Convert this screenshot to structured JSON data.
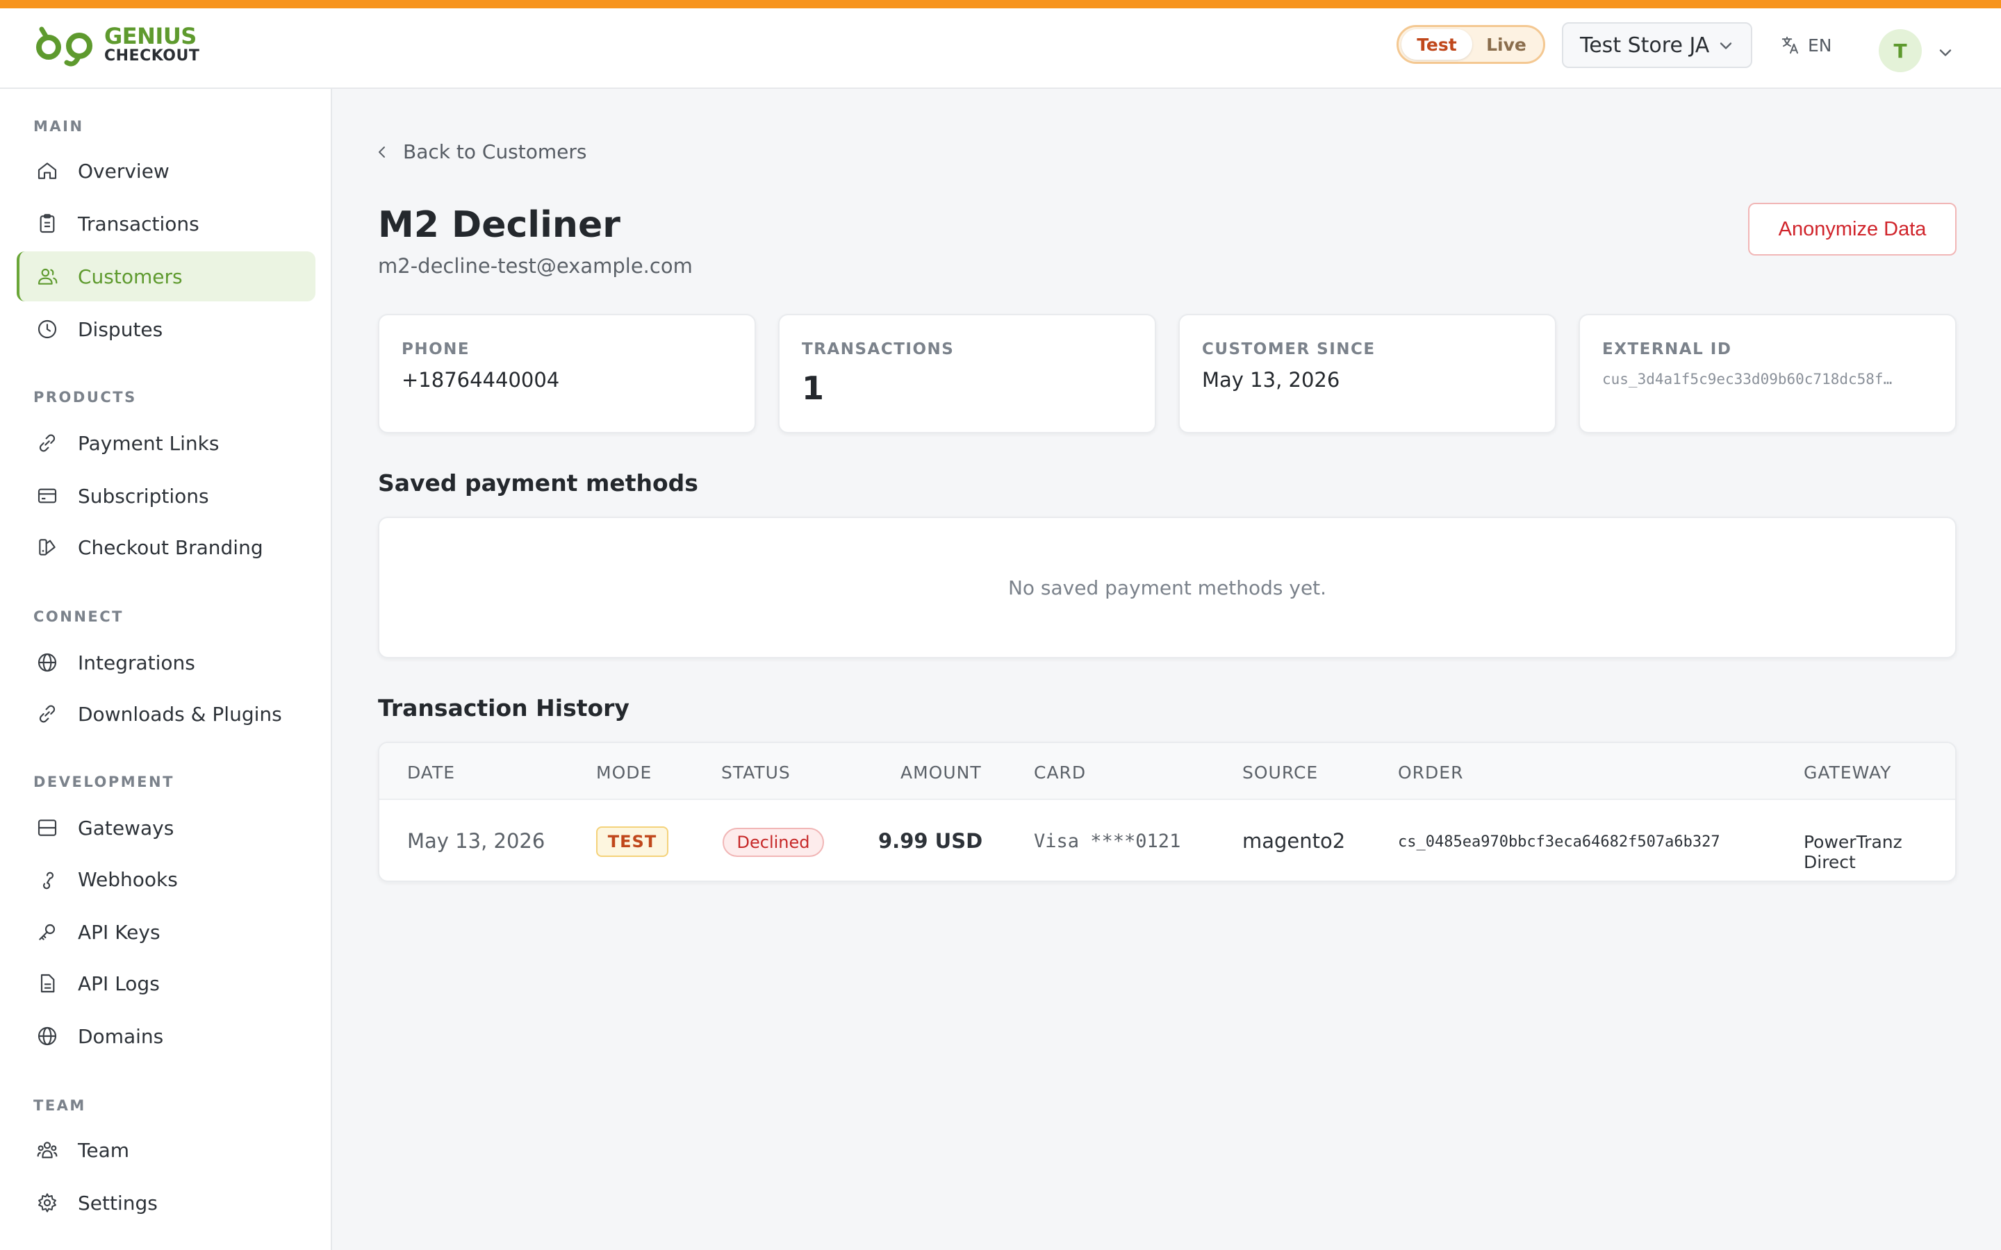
{
  "brand": {
    "line1": "GENIUS",
    "line2": "CHECKOUT"
  },
  "header": {
    "mode_test": "Test",
    "mode_live": "Live",
    "store": "Test Store JA",
    "language": "EN",
    "avatar_initial": "T"
  },
  "colors": {
    "accent_bar": "#f7941d",
    "brand_green": "#5e9a2e",
    "danger": "#d0242b"
  },
  "sidebar": {
    "sections": {
      "main": "MAIN",
      "products": "PRODUCTS",
      "connect": "CONNECT",
      "development": "DEVELOPMENT",
      "team": "TEAM"
    },
    "items": {
      "overview": "Overview",
      "transactions": "Transactions",
      "customers": "Customers",
      "disputes": "Disputes",
      "payment_links": "Payment Links",
      "subscriptions": "Subscriptions",
      "checkout_branding": "Checkout Branding",
      "integrations": "Integrations",
      "downloads_plugins": "Downloads & Plugins",
      "gateways": "Gateways",
      "webhooks": "Webhooks",
      "api_keys": "API Keys",
      "api_logs": "API Logs",
      "domains": "Domains",
      "team": "Team",
      "settings": "Settings"
    },
    "active": "customers"
  },
  "page": {
    "back_label": "Back to Customers",
    "customer_name": "M2 Decliner",
    "customer_email": "m2-decline-test@example.com",
    "anonymize_label": "Anonymize Data"
  },
  "stats": {
    "phone": {
      "label": "PHONE",
      "value": "+18764440004"
    },
    "transactions": {
      "label": "TRANSACTIONS",
      "value": "1"
    },
    "customer_since": {
      "label": "CUSTOMER SINCE",
      "value": "May 13, 2026"
    },
    "external_id": {
      "label": "EXTERNAL ID",
      "value": "cus_3d4a1f5c9ec33d09b60c718dc58f…"
    }
  },
  "saved_methods": {
    "title": "Saved payment methods",
    "empty_text": "No saved payment methods yet."
  },
  "history": {
    "title": "Transaction History",
    "columns": {
      "date": "DATE",
      "mode": "MODE",
      "status": "STATUS",
      "amount": "AMOUNT",
      "card": "CARD",
      "source": "SOURCE",
      "order": "ORDER",
      "gateway": "GATEWAY"
    },
    "rows": [
      {
        "date": "May 13, 2026",
        "mode": "TEST",
        "status": "Declined",
        "amount": "9.99 USD",
        "card": "Visa ****0121",
        "source": "magento2",
        "order": "cs_0485ea970bbcf3eca64682f507a6b327",
        "gateway": "PowerTranz Direct"
      }
    ]
  }
}
